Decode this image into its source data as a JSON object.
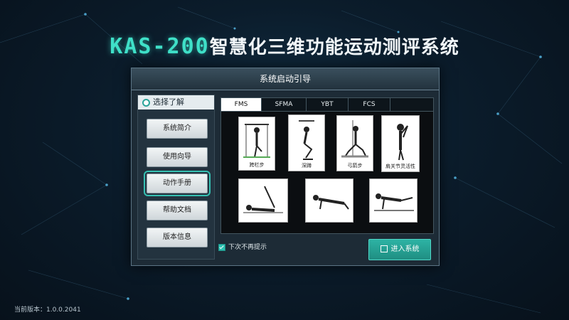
{
  "app": {
    "brand": "KAS-200",
    "name": "智慧化三维功能运动测评系统"
  },
  "dialog": {
    "title": "系统启动引导",
    "section_label": "选择了解",
    "nav": [
      "系统简介",
      "使用向导",
      "动作手册",
      "帮助文档",
      "版本信息"
    ],
    "active_nav": "动作手册",
    "tabs": [
      "FMS",
      "SFMA",
      "YBT",
      "FCS"
    ],
    "active_tab": "FMS",
    "cards": [
      {
        "caption": "跨栏步",
        "icon": "hurdle-step-figure"
      },
      {
        "caption": "深蹲",
        "icon": "deep-squat-figure"
      },
      {
        "caption": "弓箭步",
        "icon": "lunge-figure"
      },
      {
        "caption": "肩关节灵活性",
        "icon": "shoulder-mobility-figure"
      },
      {
        "caption": "",
        "icon": "leg-raise-figure"
      },
      {
        "caption": "",
        "icon": "pushup-figure"
      },
      {
        "caption": "",
        "icon": "rotary-stability-figure"
      }
    ],
    "checkbox_label": "下次不再提示",
    "checkbox_checked": true,
    "enter_button": "进入系统"
  },
  "footer": {
    "version": "当前版本：1.0.0.2041"
  }
}
